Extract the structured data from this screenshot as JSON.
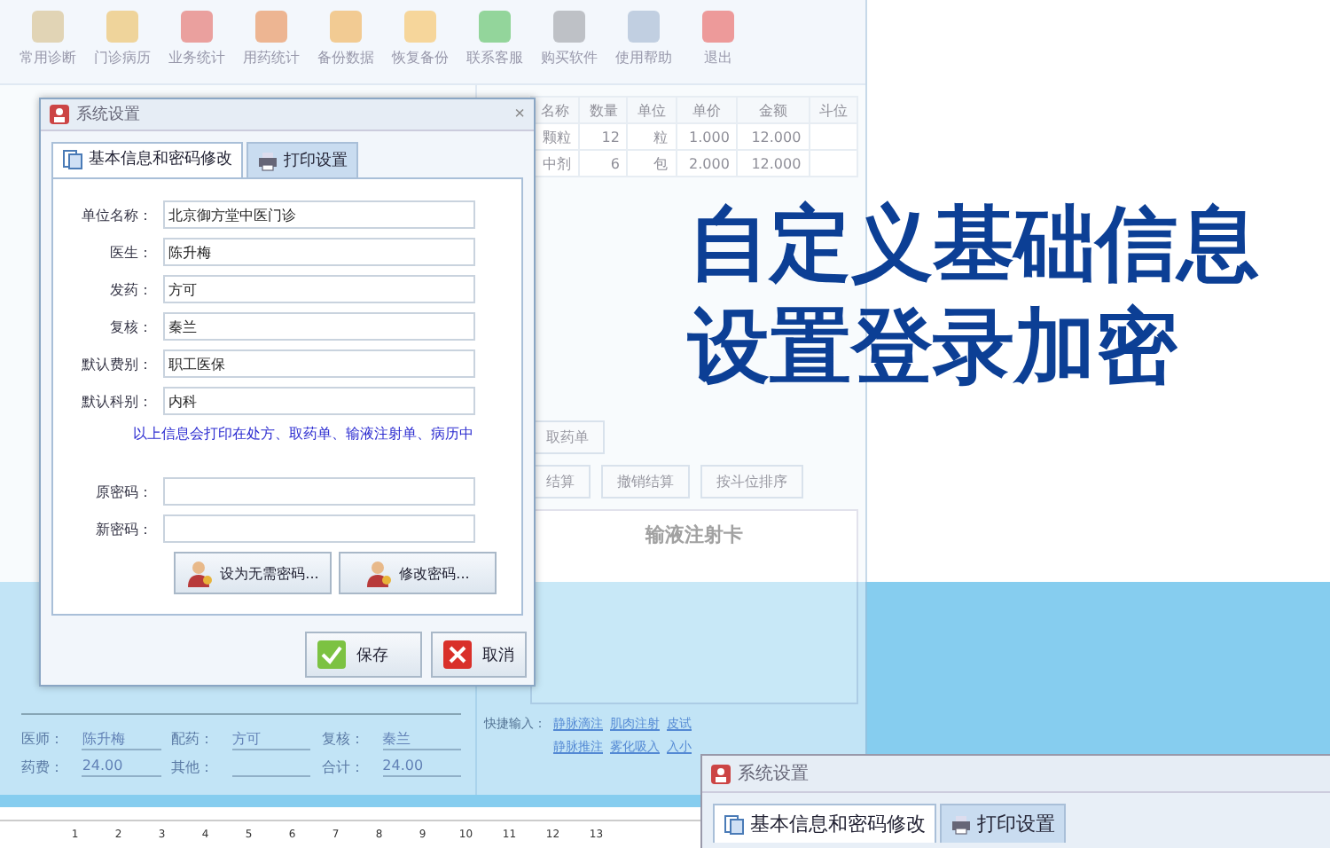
{
  "toolbar": [
    {
      "label": "常用诊断"
    },
    {
      "label": "门诊病历"
    },
    {
      "label": "业务统计"
    },
    {
      "label": "用药统计"
    },
    {
      "label": "备份数据"
    },
    {
      "label": "恢复备份"
    },
    {
      "label": "联系客服"
    },
    {
      "label": "购买软件"
    },
    {
      "label": "使用帮助"
    },
    {
      "label": "退出"
    }
  ],
  "main_window": {
    "table": {
      "columns": [
        "名称",
        "数量",
        "单位",
        "单价",
        "金额",
        "斗位"
      ],
      "rows": [
        {
          "name": "颗粒",
          "qty": "12",
          "unit": "粒",
          "price": "1.000",
          "amount": "12.000"
        },
        {
          "name": "中剂",
          "qty": "6",
          "unit": "包",
          "price": "2.000",
          "amount": "12.000"
        }
      ]
    },
    "buttons": [
      "取药单",
      "结算",
      "撤销结算",
      "按斗位排序"
    ],
    "card_title": "输液注射卡",
    "footer": [
      {
        "label": "医师：",
        "value": "陈升梅"
      },
      {
        "label": "配药：",
        "value": "方可"
      },
      {
        "label": "复核：",
        "value": "秦兰"
      },
      {
        "label": "药费：",
        "value": "24.00"
      },
      {
        "label": "其他："
      },
      {
        "label": "合计：",
        "value": "24.00"
      }
    ],
    "quick_input": {
      "label": "快捷输入：",
      "links": [
        "静脉滴注",
        "肌肉注射",
        "皮试",
        "静脉推注",
        "雾化吸入",
        "入小"
      ]
    }
  },
  "dialog": {
    "title": "系统设置",
    "close": "×",
    "tabs": [
      {
        "label": "基本信息和密码修改",
        "selected": true
      },
      {
        "label": "打印设置",
        "selected": false
      }
    ],
    "fields": [
      {
        "label": "单位名称：",
        "value": "北京御方堂中医门诊"
      },
      {
        "label": "医生：",
        "value": "陈升梅"
      },
      {
        "label": "发药：",
        "value": "方可"
      },
      {
        "label": "复核：",
        "value": "秦兰"
      },
      {
        "label": "默认费别：",
        "value": "职工医保"
      },
      {
        "label": "默认科别：",
        "value": "内科"
      }
    ],
    "note": "以上信息会打印在处方、取药单、输液注射单、病历中",
    "password_fields": [
      {
        "label": "原密码："
      },
      {
        "label": "新密码："
      }
    ],
    "password_buttons": [
      "设为无需密码...",
      "修改密码..."
    ],
    "buttons": [
      {
        "label": "保存",
        "kind": "ok"
      },
      {
        "label": "取消",
        "kind": "cancel"
      }
    ]
  },
  "headline": [
    "自定义基础信息",
    "设置登录加密"
  ],
  "second_dialog": {
    "title": "系统设置",
    "tabs": [
      {
        "label": "基本信息和密码修改",
        "selected": true
      },
      {
        "label": "打印设置",
        "selected": false
      }
    ]
  },
  "ruler": [
    "1",
    "2",
    "3",
    "4",
    "5",
    "6",
    "7",
    "8",
    "9",
    "10",
    "11",
    "12",
    "13"
  ]
}
